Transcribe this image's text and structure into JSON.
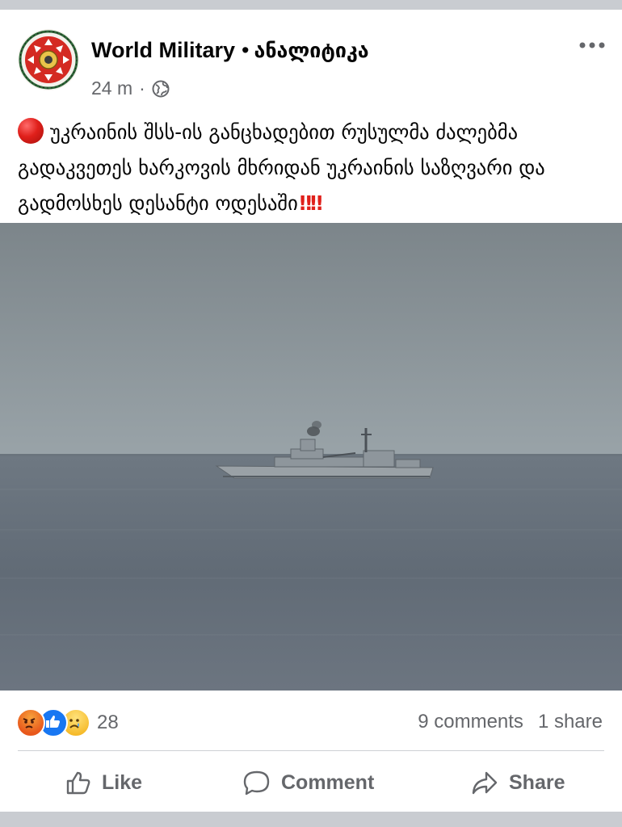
{
  "post": {
    "page_name": "World Military",
    "separator": "•",
    "group_name": "ანალიტიკა",
    "time": "24 m",
    "time_separator": "·",
    "audience_icon": "globe-icon",
    "more_icon": "more-dots-icon",
    "text": "უკრაინის შსს-ის განცხადებით რუსულმა ძალებმა გადაკვეთეს ხარკოვის მხრიდან უკრაინის საზღვარი და გადმოსხეს დესანტი ოდესაში",
    "text_emoji_start": "red-circle-icon",
    "text_emoji_end": "‼‼",
    "image": "grey-warship-on-sea-photo"
  },
  "stats": {
    "reaction_icons": [
      "angry-reaction-icon",
      "like-reaction-icon",
      "sad-reaction-icon"
    ],
    "reaction_count": "28",
    "comments": "9 comments",
    "shares": "1 share"
  },
  "actions": {
    "like": "Like",
    "comment": "Comment",
    "share": "Share"
  },
  "colors": {
    "secondary_text": "#65676b",
    "like_blue": "#1877f2",
    "alert_red": "#e0201b"
  }
}
